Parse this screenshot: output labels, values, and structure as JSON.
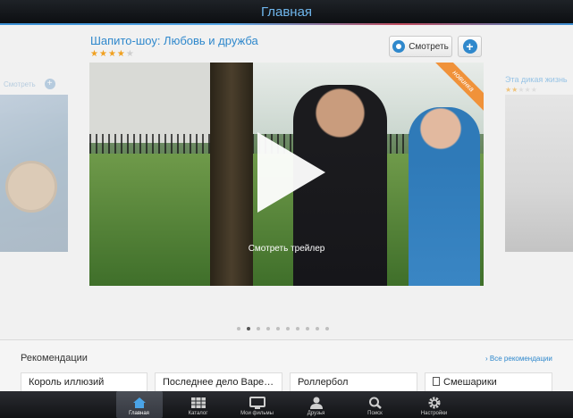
{
  "header": {
    "title": "Главная"
  },
  "featured": {
    "title": "Шапито-шоу: Любовь и дружба",
    "rating": 4,
    "rating_max": 5,
    "watch_label": "Смотреть",
    "badge": "новинка",
    "trailer_label": "Смотреть трейлер"
  },
  "side_left": {
    "watch_label": "Смотреть"
  },
  "side_right": {
    "title": "Эта дикая жизнь",
    "rating": 2,
    "rating_max": 5
  },
  "pagination": {
    "count": 10,
    "active_index": 1
  },
  "recommendations": {
    "title": "Рекомендации",
    "all_label": "Все рекомендации",
    "items": [
      {
        "title": "Король иллюзий"
      },
      {
        "title": "Последнее дело Варе…"
      },
      {
        "title": "Роллербол"
      },
      {
        "title": "Смешарики"
      }
    ]
  },
  "tabs": [
    {
      "label": "Главная",
      "icon": "home-icon",
      "active": true
    },
    {
      "label": "Каталог",
      "icon": "grid-icon",
      "active": false
    },
    {
      "label": "Мои фильмы",
      "icon": "tv-icon",
      "active": false
    },
    {
      "label": "Друзья",
      "icon": "person-icon",
      "active": false
    },
    {
      "label": "Поиск",
      "icon": "search-icon",
      "active": false
    },
    {
      "label": "Настройки",
      "icon": "gear-icon",
      "active": false
    }
  ],
  "colors": {
    "accent": "#2f88cc",
    "star": "#f0a020",
    "ribbon": "#f0923a"
  }
}
